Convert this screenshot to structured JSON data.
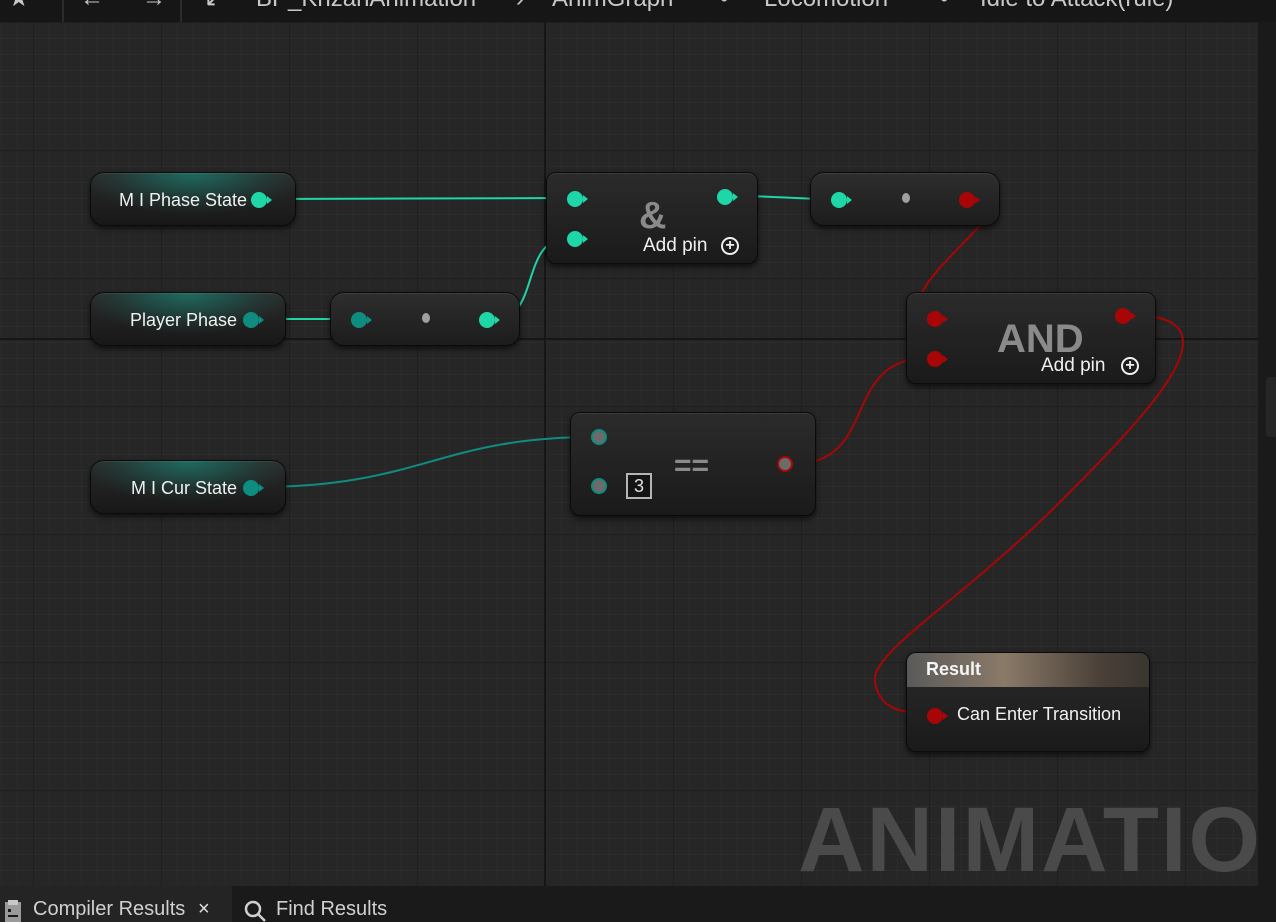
{
  "toolbar": {
    "star_icon": "★",
    "back_icon": "←",
    "forward_icon": "→",
    "expand_icon": "↙",
    "breadcrumbs": [
      "BP_KhzanAnimation",
      "AnimGraph",
      "Locomotion",
      "Idle to Attack(rule)"
    ],
    "sep1": "›",
    "sep2": "•",
    "sep3": "•"
  },
  "nodes": {
    "phase_state": {
      "label": "M I Phase State"
    },
    "player_phase": {
      "label": "Player Phase"
    },
    "cur_state": {
      "label": "M I Cur State"
    },
    "bitwise_and": {
      "symbol": "&",
      "add_pin": "Add pin"
    },
    "logic_and": {
      "symbol": "AND",
      "add_pin": "Add pin"
    },
    "equal": {
      "symbol": "==",
      "literal": "3"
    },
    "result": {
      "header": "Result",
      "pin_label": "Can Enter Transition"
    }
  },
  "watermark": "ANIMATION",
  "bottom_tabs": [
    {
      "label": "Compiler Results",
      "close": "×",
      "active": true
    },
    {
      "label": "Find Results",
      "active": false
    }
  ],
  "colors": {
    "int_pin": "#1ed6a8",
    "enum_pin": "#0f8c80",
    "bool_pin": "#a80606",
    "graph_bg": "#262626"
  }
}
